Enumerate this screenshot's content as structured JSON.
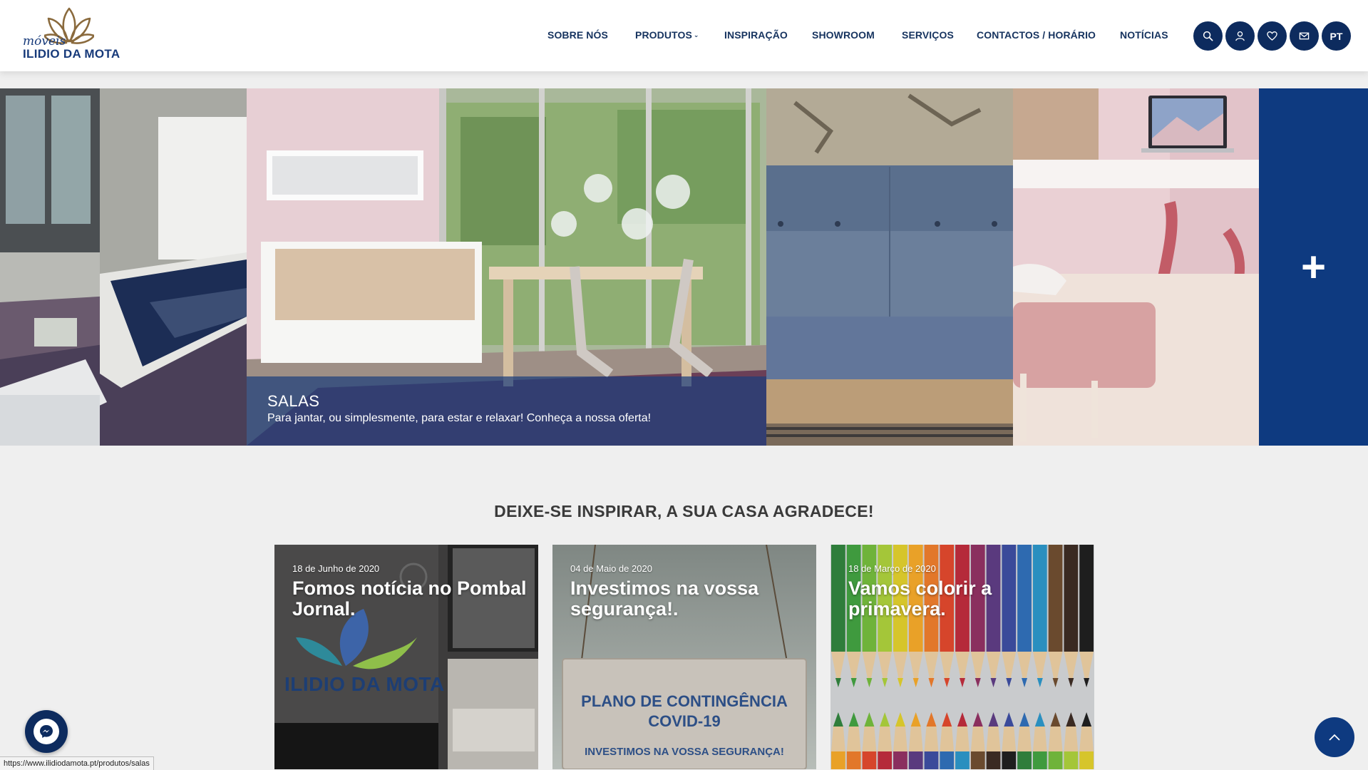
{
  "brand": {
    "small": "móveis",
    "name": "ILIDIO DA MOTA",
    "color": "#173a7a"
  },
  "nav": {
    "items": [
      {
        "label": "SOBRE NÓS"
      },
      {
        "label": "PRODUTOS"
      },
      {
        "label": "INSPIRAÇÃO"
      },
      {
        "label": "SHOWROOM"
      },
      {
        "label": "SERVIÇOS"
      },
      {
        "label": "CONTACTOS / HORÁRIO"
      },
      {
        "label": "NOTÍCIAS"
      }
    ],
    "icons": [
      "search-icon",
      "user-icon",
      "heart-icon",
      "mail-icon"
    ],
    "language": "PT",
    "accent": "#0d2b5e"
  },
  "hero": {
    "active_caption": {
      "title": "SALAS",
      "text": "Para jantar, ou simplesmente, para estar e relaxar! Conheça a nossa oferta!"
    },
    "more_icon": "plus-icon"
  },
  "inspiration": {
    "title": "DEIXE-SE INSPIRAR, A SUA CASA AGRADECE!",
    "cards": [
      {
        "date": "18 de Junho de 2020",
        "title": "Fomos notícia no Pombal Jornal."
      },
      {
        "date": "04 de Maio de 2020",
        "title": "Investimos na vossa segurança!.",
        "sign_line1": "PLANO DE CONTINGÊNCIA",
        "sign_line2": "COVID-19",
        "sign_line3": "INVESTIMOS NA VOSSA SEGURANÇA!"
      },
      {
        "date": "18 de Março de 2020",
        "title": "Vamos colorir a primavera."
      }
    ]
  },
  "status_bar": {
    "url": "https://www.ilidiodamota.pt/produtos/salas"
  }
}
